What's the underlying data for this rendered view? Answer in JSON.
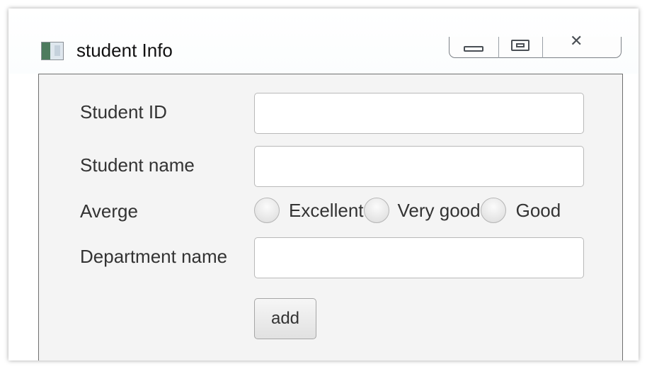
{
  "window": {
    "title": "student Info",
    "controls": {
      "minimize": "minimize-icon",
      "maximize": "maximize-icon",
      "close": "close-icon"
    }
  },
  "form": {
    "student_id": {
      "label": "Student ID",
      "value": "",
      "placeholder": ""
    },
    "student_name": {
      "label": "Student name",
      "value": "",
      "placeholder": ""
    },
    "average": {
      "label": "Averge",
      "options": [
        "Excellent",
        "Very good",
        "Good"
      ],
      "selected": null
    },
    "department_name": {
      "label": "Department name",
      "value": "",
      "placeholder": ""
    },
    "add_button": "add"
  },
  "colors": {
    "panel_background": "#f4f4f4",
    "panel_border": "#6f6f6f",
    "label_text": "#333333"
  }
}
